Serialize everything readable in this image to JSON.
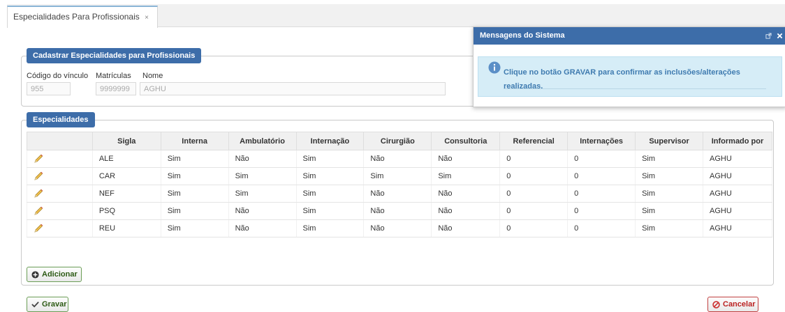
{
  "tab": {
    "label": "Especialidades Para Profissionais",
    "close": "×"
  },
  "cadastro": {
    "legend": "Cadastrar Especialidades para Profissionais",
    "codigo_label": "Código do vínculo",
    "codigo_value": "955",
    "matriculas_label": "Matrículas",
    "matriculas_value": "9999999",
    "nome_label": "Nome",
    "nome_value": "AGHU"
  },
  "especialidades": {
    "legend": "Especialidades",
    "columns": [
      "Sigla",
      "Interna",
      "Ambulatório",
      "Internação",
      "Cirurgião",
      "Consultoria",
      "Referencial",
      "Internações",
      "Supervisor",
      "Informado por"
    ],
    "rows": [
      [
        "ALE",
        "Sim",
        "Não",
        "Sim",
        "Não",
        "Não",
        "0",
        "0",
        "Sim",
        "AGHU"
      ],
      [
        "CAR",
        "Sim",
        "Sim",
        "Sim",
        "Sim",
        "Sim",
        "0",
        "0",
        "Sim",
        "AGHU"
      ],
      [
        "NEF",
        "Sim",
        "Sim",
        "Sim",
        "Não",
        "Não",
        "0",
        "0",
        "Sim",
        "AGHU"
      ],
      [
        "PSQ",
        "Sim",
        "Não",
        "Sim",
        "Não",
        "Não",
        "0",
        "0",
        "Sim",
        "AGHU"
      ],
      [
        "REU",
        "Sim",
        "Não",
        "Sim",
        "Não",
        "Não",
        "0",
        "0",
        "Sim",
        "AGHU"
      ]
    ],
    "edit_icon": "pencil-icon"
  },
  "buttons": {
    "adicionar": "Adicionar",
    "gravar": "Gravar",
    "cancelar": "Cancelar"
  },
  "mensagens": {
    "title": "Mensagens do Sistema",
    "text": "Clique no botão GRAVAR para confirmar as inclusões/alterações realizadas.",
    "icon": "info-icon"
  },
  "colors": {
    "header_blue": "#3d6da9",
    "info_bg": "#d6edf7",
    "info_text": "#3f7bb0",
    "button_green": "#6a9d55",
    "button_red": "#c04040"
  }
}
